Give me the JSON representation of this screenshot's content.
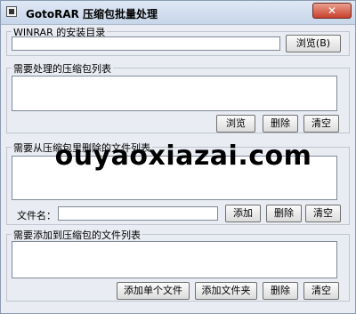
{
  "window": {
    "title": "GotoRAR 压缩包批量处理",
    "close_glyph": "✕"
  },
  "winrar_group": {
    "label": "WINRAR 的安装目录",
    "path_value": "",
    "browse_label": "浏览(B)"
  },
  "archives_group": {
    "label": "需要处理的压缩包列表",
    "browse_label": "浏览",
    "delete_label": "删除",
    "clear_label": "清空"
  },
  "remove_group": {
    "label": "需要从压缩包里删除的文件列表",
    "filename_label": "文件名：",
    "filename_value": "",
    "add_label": "添加",
    "delete_label": "删除",
    "clear_label": "清空"
  },
  "add_group": {
    "label": "需要添加到压缩包的文件列表",
    "add_single_label": "添加单个文件",
    "add_folder_label": "添加文件夹",
    "delete_label": "删除",
    "clear_label": "清空"
  },
  "watermark": {
    "text": "ouyaoxiazai.com"
  }
}
